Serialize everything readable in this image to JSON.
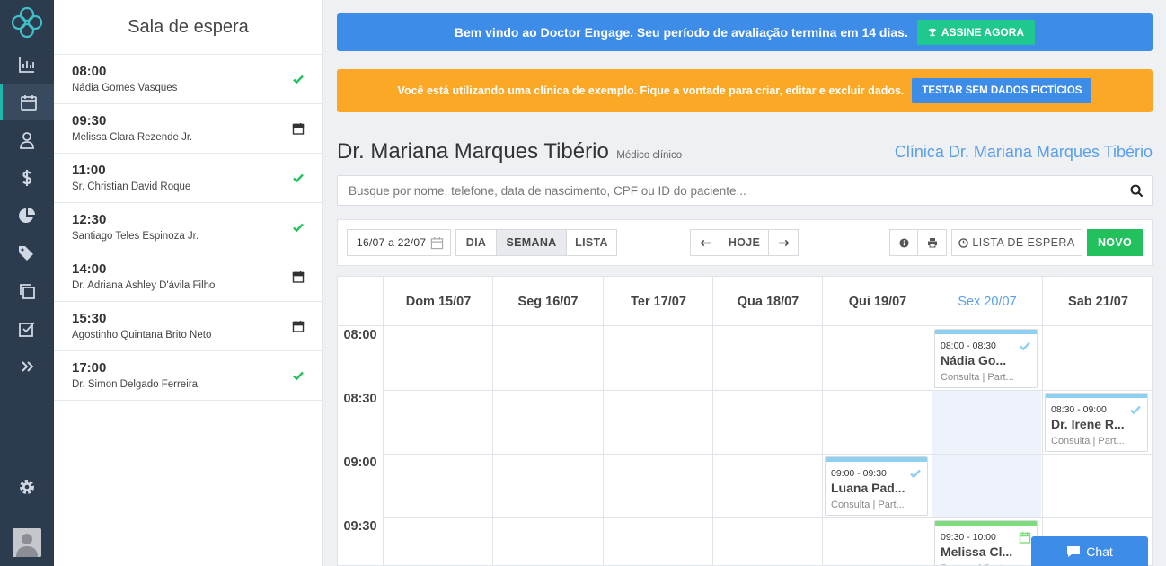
{
  "sidebar": {
    "icons": [
      "logo-icon",
      "chart-icon",
      "calendar-icon",
      "user-icon",
      "dollar-icon",
      "pie-chart-icon",
      "tags-icon",
      "copy-icon",
      "checkbox-icon",
      "double-chevron-icon",
      "gear-icon",
      "avatar"
    ]
  },
  "waiting_room": {
    "title": "Sala de espera",
    "items": [
      {
        "time": "08:00",
        "name": "Nádia Gomes Vasques",
        "status": "check-icon"
      },
      {
        "time": "09:30",
        "name": "Melissa Clara Rezende Jr.",
        "status": "calendar-icon"
      },
      {
        "time": "11:00",
        "name": "Sr. Christian David Roque",
        "status": "check-icon"
      },
      {
        "time": "12:30",
        "name": "Santiago Teles Espinoza Jr.",
        "status": "check-icon"
      },
      {
        "time": "14:00",
        "name": "Dr. Adriana Ashley D'ávila Filho",
        "status": "calendar-icon"
      },
      {
        "time": "15:30",
        "name": "Agostinho Quintana Brito Neto",
        "status": "calendar-icon"
      },
      {
        "time": "17:00",
        "name": "Dr. Simon Delgado Ferreira",
        "status": "check-icon"
      }
    ]
  },
  "banner": {
    "welcome": "Bem vindo ao Doctor Engage. Seu período de avaliação termina em 14 dias.",
    "subscribe": "ASSINE AGORA",
    "example_notice": "Você está utilizando uma clínica de exemplo. Fique a vontade para criar, editar e excluir dados.",
    "test_button": "TESTAR SEM DADOS FICTÍCIOS"
  },
  "doctor": {
    "name": "Dr. Mariana Marques Tibério",
    "specialty": "Médico clínico",
    "clinic": "Clínica Dr. Mariana Marques Tibério"
  },
  "search": {
    "placeholder": "Busque por nome, telefone, data de nascimento, CPF ou ID do paciente..."
  },
  "toolbar": {
    "date_range": "16/07 a 22/07",
    "view_day": "DIA",
    "view_week": "SEMANA",
    "view_list": "LISTA",
    "today": "HOJE",
    "waitlist": "LISTA DE ESPERA",
    "new": "NOVO"
  },
  "calendar": {
    "days": [
      "Dom 15/07",
      "Seg 16/07",
      "Ter 17/07",
      "Qua 18/07",
      "Qui 19/07",
      "Sex 20/07",
      "Sab 21/07"
    ],
    "today_index": 5,
    "times": [
      "08:00",
      "08:30",
      "09:00",
      "09:30"
    ],
    "appointments": [
      {
        "day": "Sex 20/07",
        "time": "08:00 - 08:30",
        "name": "Nádia Go...",
        "type": "Consulta | Part...",
        "status": "check-icon"
      },
      {
        "day": "Sab 21/07",
        "time": "08:30 - 09:00",
        "name": "Dr. Irene R...",
        "type": "Consulta | Part...",
        "status": "check-icon"
      },
      {
        "day": "Qui 19/07",
        "time": "09:00 - 09:30",
        "name": "Luana Pad...",
        "type": "Consulta | Part...",
        "status": "check-icon"
      },
      {
        "day": "Sex 20/07",
        "time": "09:30 - 10:00",
        "name": "Melissa Cl...",
        "type": "Retorno | Part...",
        "status": "calendar-icon"
      }
    ]
  },
  "chat": {
    "label": "Chat"
  },
  "colors": {
    "sidebar": "#2d3b4e",
    "blue": "#3d8ce8",
    "orange": "#fca827",
    "green": "#22c15e",
    "teal": "#1fc98e"
  }
}
